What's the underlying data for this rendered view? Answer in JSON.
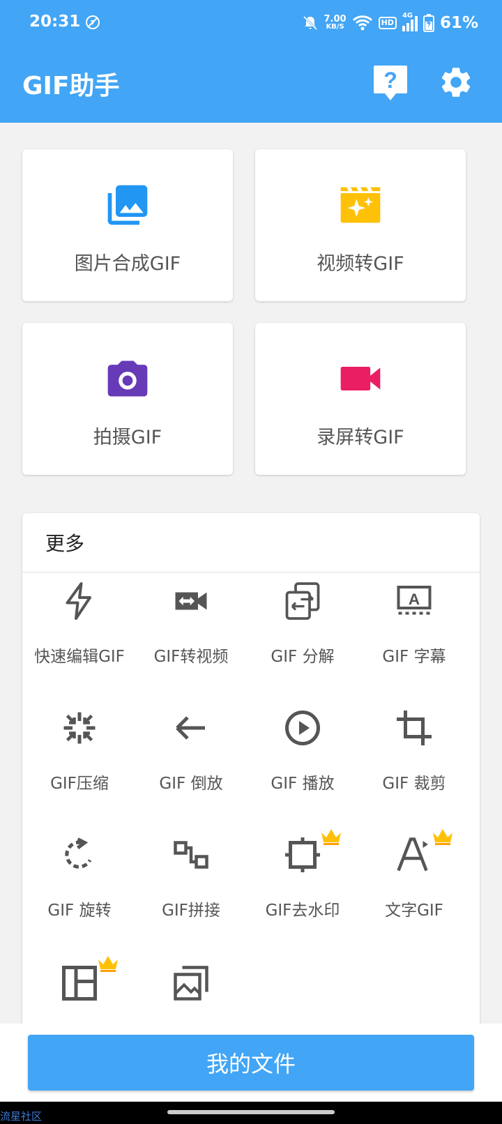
{
  "status_bar": {
    "time": "20:31",
    "net_speed_value": "7.00",
    "net_speed_unit": "KB/S",
    "hd": "HD",
    "network": "4G",
    "battery": "61%"
  },
  "app_bar": {
    "title": "GIF助手",
    "help_icon": "help-bubble-icon",
    "settings_icon": "gear-icon"
  },
  "main_cards": [
    {
      "label": "图片合成GIF",
      "icon": "photo-library-icon",
      "color": "#2196f3"
    },
    {
      "label": "视频转GIF",
      "icon": "movie-sparkle-icon",
      "color": "#ffc107"
    },
    {
      "label": "拍摄GIF",
      "icon": "camera-icon",
      "color": "#673ab7"
    },
    {
      "label": "录屏转GIF",
      "icon": "videocam-icon",
      "color": "#e91e63"
    }
  ],
  "more_section": {
    "title": "更多",
    "tools": [
      {
        "label": "快速编辑GIF",
        "icon": "flash-icon"
      },
      {
        "label": "GIF转视频",
        "icon": "video-convert-icon"
      },
      {
        "label": "GIF 分解",
        "icon": "split-icon"
      },
      {
        "label": "GIF 字幕",
        "icon": "subtitles-icon"
      },
      {
        "label": "GIF压缩",
        "icon": "compress-icon"
      },
      {
        "label": "GIF 倒放",
        "icon": "arrow-left-icon"
      },
      {
        "label": "GIF 播放",
        "icon": "play-circle-icon"
      },
      {
        "label": "GIF 裁剪",
        "icon": "crop-icon"
      },
      {
        "label": "GIF 旋转",
        "icon": "rotate-icon",
        "premium": false
      },
      {
        "label": "GIF拼接",
        "icon": "join-icon",
        "premium": false
      },
      {
        "label": "GIF去水印",
        "icon": "remove-watermark-icon",
        "premium": true
      },
      {
        "label": "文字GIF",
        "icon": "text-icon",
        "premium": true
      },
      {
        "label": "",
        "icon": "layout-icon",
        "premium": true
      },
      {
        "label": "",
        "icon": "gallery-icon",
        "premium": false
      }
    ]
  },
  "bottom": {
    "files_button": "我的文件"
  },
  "watermark": "流星社区",
  "colors": {
    "primary": "#42a5f5",
    "icon_gray": "#555555",
    "crown": "#ffc107"
  }
}
